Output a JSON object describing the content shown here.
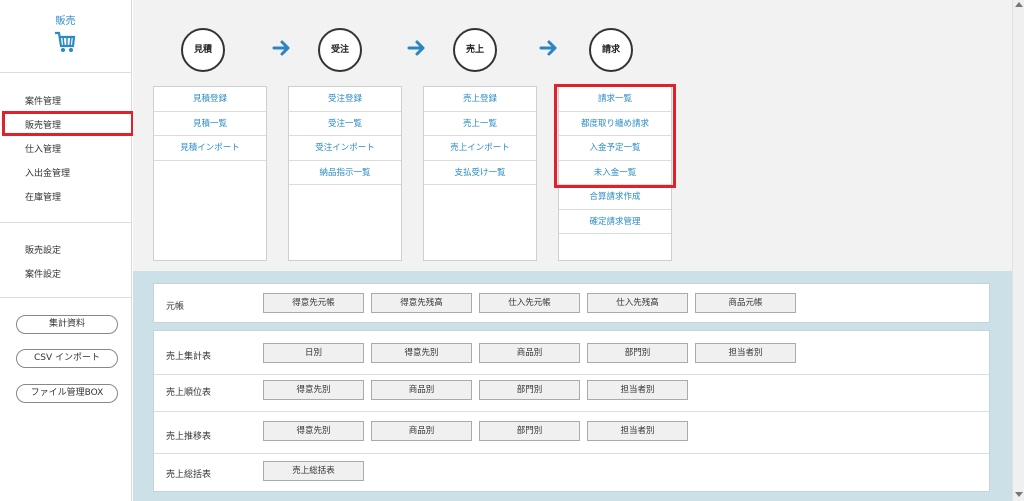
{
  "sidebar": {
    "brand_label": "販売",
    "brand_icon": "shopping-cart-icon",
    "nav": [
      "案件管理",
      "販売管理",
      "仕入管理",
      "入出金管理",
      "在庫管理"
    ],
    "settings": [
      "販売設定",
      "案件設定"
    ],
    "pills": [
      "集計資料",
      "CSV インポート",
      "ファイル管理BOX"
    ]
  },
  "flow": {
    "steps": [
      "見積",
      "受注",
      "売上",
      "請求"
    ],
    "arrow_icon": "arrow-right-icon",
    "columns": [
      [
        "見積登録",
        "見積一覧",
        "見積インポート"
      ],
      [
        "受注登録",
        "受注一覧",
        "受注インポート",
        "納品指示一覧"
      ],
      [
        "売上登録",
        "売上一覧",
        "売上インポート",
        "支払受け一覧"
      ],
      [
        "請求一覧",
        "都度取り纏め請求",
        "入金予定一覧",
        "未入金一覧",
        "合算請求作成",
        "確定請求管理"
      ]
    ]
  },
  "reports": [
    {
      "label": "元帳",
      "buttons": [
        "得意先元帳",
        "得意先残高",
        "仕入先元帳",
        "仕入先残高",
        "商品元帳"
      ]
    },
    {
      "label": "売上集計表",
      "buttons": [
        "日別",
        "得意先別",
        "商品別",
        "部門別",
        "担当者別"
      ]
    },
    {
      "label": "売上順位表",
      "buttons": [
        "得意先別",
        "商品別",
        "部門別",
        "担当者別"
      ]
    },
    {
      "label": "売上推移表",
      "buttons": [
        "得意先別",
        "商品別",
        "部門別",
        "担当者別"
      ]
    },
    {
      "label": "売上総括表",
      "buttons": [
        "売上総括表"
      ]
    }
  ],
  "colors": {
    "accent": "#2a8bc7",
    "highlight": "#e0202a",
    "arrow": "#2a86c3",
    "lower_panel": "#cce1e7"
  }
}
